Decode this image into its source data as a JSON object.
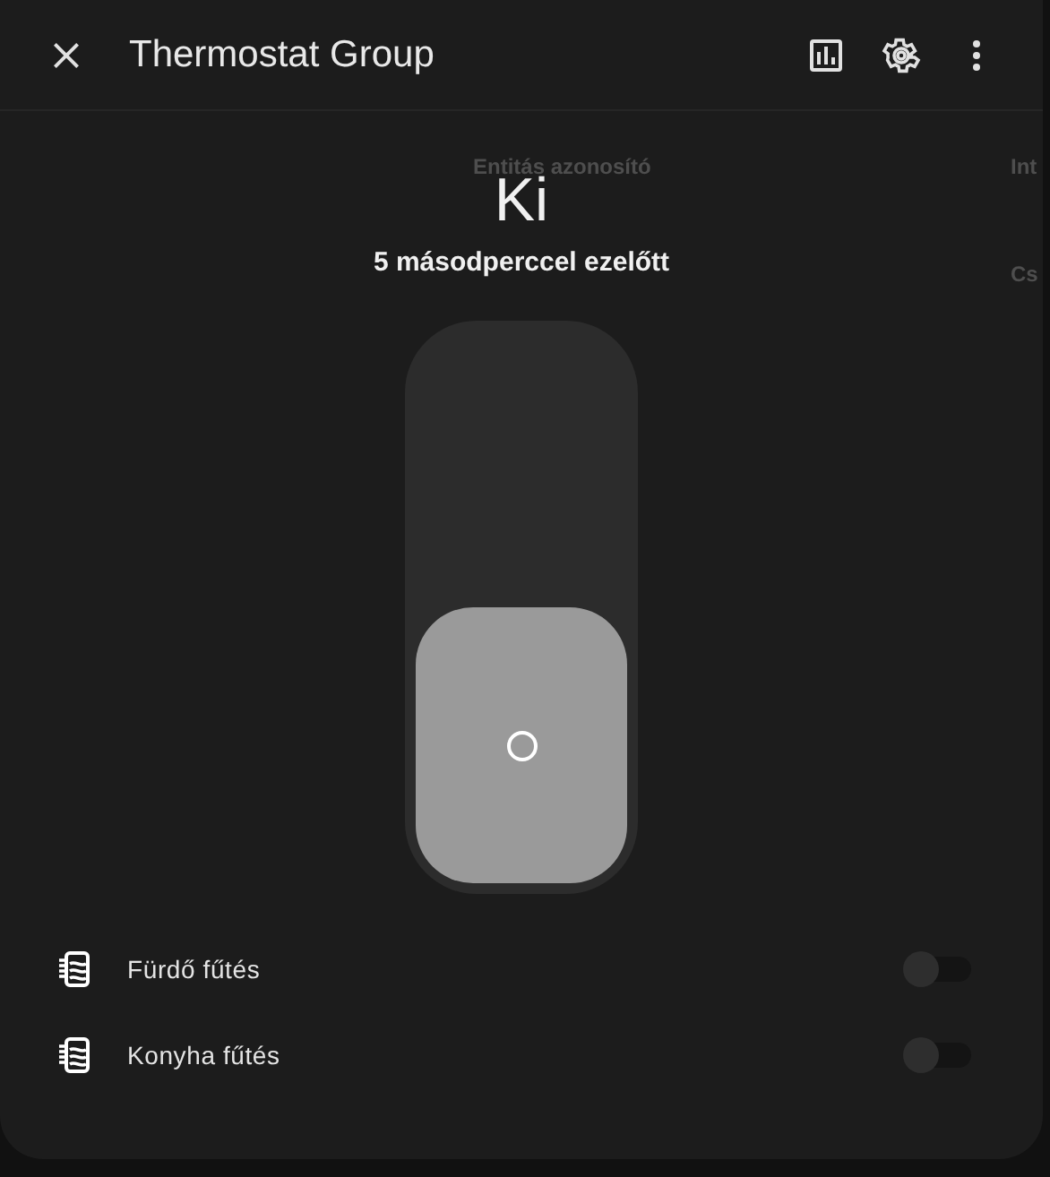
{
  "backdrop": [
    "Entitás azonosító",
    "Int",
    "Cs"
  ],
  "dialog": {
    "title": "Thermostat Group"
  },
  "state": {
    "text": "Ki",
    "changed": "5 másodperccel ezelőtt"
  },
  "switch": {
    "on": false
  },
  "members": [
    {
      "name": "Fürdő fűtés",
      "on": false
    },
    {
      "name": "Konyha fűtés",
      "on": false
    }
  ]
}
